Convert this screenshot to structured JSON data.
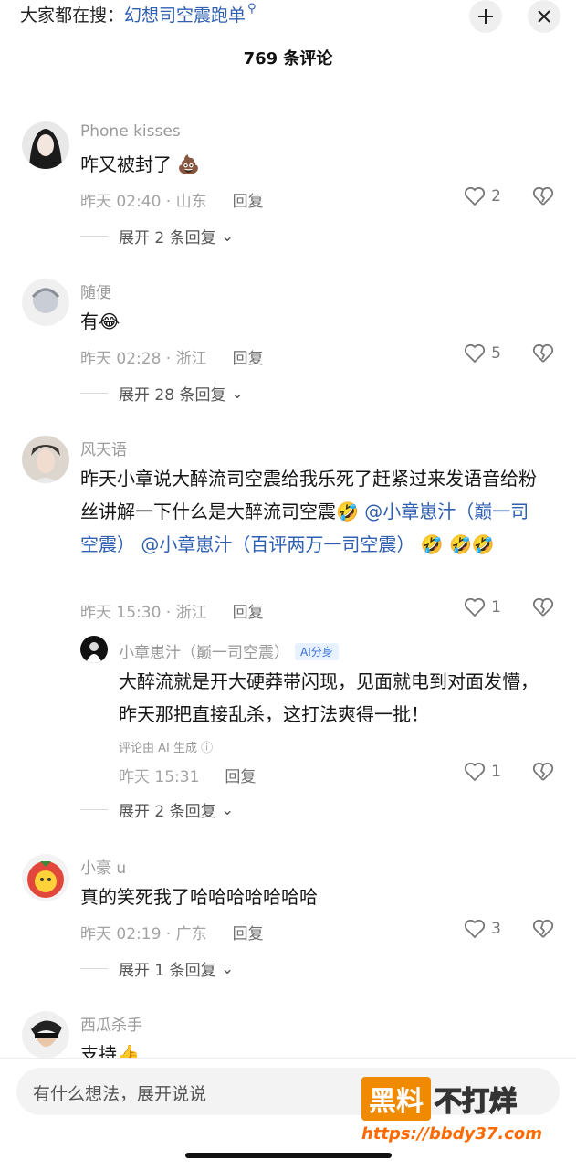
{
  "header": {
    "search_prefix": "大家都在搜：",
    "search_keyword": "幻想司空震跑单",
    "search_icon": "search-icon",
    "collapse_icon": "collapse-icon",
    "close_icon": "close-icon",
    "title": "769 条评论"
  },
  "comments": [
    {
      "user": "Phone kisses",
      "text": "咋又被封了",
      "time": "昨天 02:40 · 山东",
      "reply_label": "回复",
      "likes": "2",
      "expand": "展开 2 条回复"
    },
    {
      "user": "随便",
      "text": "有",
      "time": "昨天 02:28 · 浙江",
      "reply_label": "回复",
      "likes": "5",
      "expand": "展开 28 条回复"
    },
    {
      "user": "风天语",
      "text": "昨天小章说大醉流司空震给我乐死了赶紧过来发语音给粉丝讲解一下什么是大醉流司空震",
      "mention1": "@小章崽汁（巅一司空震）",
      "mention2": "@小章崽汁（百评两万一司空震）",
      "time": "昨天 15:30 · 浙江",
      "reply_label": "回复",
      "likes": "1",
      "reply": {
        "user": "小章崽汁（巅一司空震）",
        "tag": "AI分身",
        "text": "大醉流就是开大硬莽带闪现，见面就电到对面发懵，昨天那把直接乱杀，这打法爽得一批！",
        "ai_note": "评论由 AI 生成 ⓘ",
        "time": "昨天 15:31",
        "reply_label": "回复",
        "likes": "1"
      },
      "expand": "展开 2 条回复"
    },
    {
      "user": "小豪 u",
      "text": "真的笑死我了哈哈哈哈哈哈哈",
      "time": "昨天 02:19 · 广东",
      "reply_label": "回复",
      "likes": "3",
      "expand": "展开 1 条回复"
    },
    {
      "user": "西瓜杀手",
      "text": "支持"
    }
  ],
  "composer": {
    "placeholder": "有什么想法，展开说说"
  },
  "watermark": {
    "box": "黑料",
    "text": "不打烊",
    "url": "https://bbdy37.com"
  }
}
